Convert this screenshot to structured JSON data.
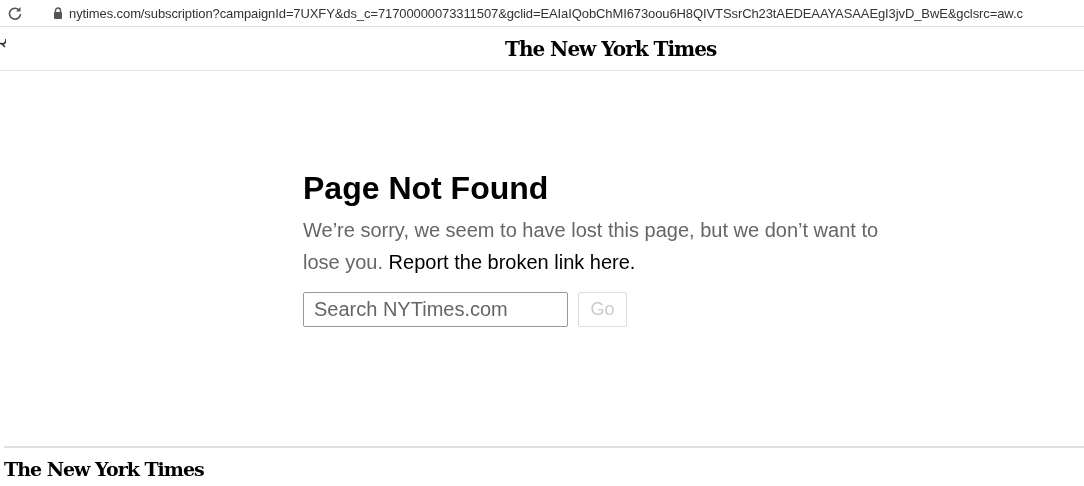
{
  "browser": {
    "url": "nytimes.com/subscription?campaignId=7UXFY&ds_c=71700000073311507&gclid=EAIaIQobChMI673oou6H8QIVTSsrCh23tAEDEAAYASAAEgI3jvD_BwE&gclsrc=aw.c"
  },
  "header": {
    "logo": "The New York Times"
  },
  "error": {
    "title": "Page Not Found",
    "message": "We’re sorry, we seem to have lost this page, but we don’t want to lose you.",
    "link": "Report the broken link here."
  },
  "search": {
    "placeholder": "Search NYTimes.com",
    "button": "Go",
    "button_disabled": true
  },
  "footer": {
    "logo": "The New York Times"
  }
}
